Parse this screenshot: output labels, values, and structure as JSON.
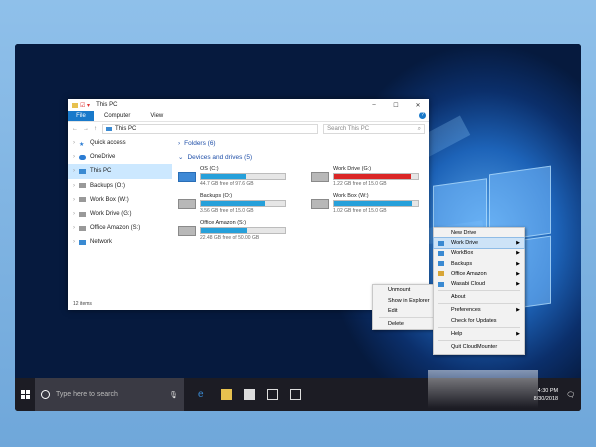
{
  "explorer": {
    "title": "This PC",
    "window_controls": [
      "–",
      "☐",
      "✕"
    ],
    "ribbon_tabs": [
      "File",
      "Computer",
      "View"
    ],
    "help": "?",
    "nav_arrows": [
      "←",
      "→",
      "↑"
    ],
    "address": "This PC",
    "search_placeholder": "Search This PC",
    "nav_items": [
      {
        "label": "Quick access",
        "icon": "star-icon"
      },
      {
        "label": "OneDrive",
        "icon": "cloud-icon"
      },
      {
        "label": "This PC",
        "icon": "computer-icon"
      },
      {
        "label": "Backups (O:)",
        "icon": "drive-icon"
      },
      {
        "label": "Work Box (W:)",
        "icon": "drive-icon"
      },
      {
        "label": "Work Drive (G:)",
        "icon": "drive-icon"
      },
      {
        "label": "Office Amazon (S:)",
        "icon": "drive-icon"
      },
      {
        "label": "Network",
        "icon": "network-icon"
      }
    ],
    "folders_header": "Folders (6)",
    "devices_header": "Devices and drives (5)",
    "drives": [
      {
        "name": "OS (C:)",
        "free": "44.7 GB free of 97.6 GB",
        "used_fraction": 0.54
      },
      {
        "name": "Work Drive (G:)",
        "free": "1.22 GB free of 15.0 GB",
        "used_fraction": 0.92
      },
      {
        "name": "Backups (O:)",
        "free": "3.56 GB free of 15.0 GB",
        "used_fraction": 0.76
      },
      {
        "name": "Work Box (W:)",
        "free": "1.02 GB free of 15.0 GB",
        "used_fraction": 0.93
      },
      {
        "name": "Office Amazon (S:)",
        "free": "22.48 GB free of 50.00 GB",
        "used_fraction": 0.55
      }
    ],
    "status": "12 items"
  },
  "taskbar": {
    "search_placeholder": "Type here to search",
    "clock_time": "4:30 PM",
    "clock_date": "8/30/2018"
  },
  "context_menu": {
    "items": [
      "Unmount",
      "Show in Explorer",
      "Edit",
      "Delete"
    ]
  },
  "cloud_menu": {
    "new_drive": "New Drive",
    "drives": [
      {
        "label": "Work Drive"
      },
      {
        "label": "WorkBox"
      },
      {
        "label": "Backups"
      },
      {
        "label": "Office Amazon"
      },
      {
        "label": "Wasabi Cloud"
      }
    ],
    "about": "About",
    "preferences": "Preferences",
    "check_updates": "Check for Updates",
    "help": "Help",
    "quit": "Quit CloudMounter"
  },
  "colors": {
    "accent": "#1979ca",
    "bar": "#26a0da",
    "bar_full": "#da2626"
  }
}
